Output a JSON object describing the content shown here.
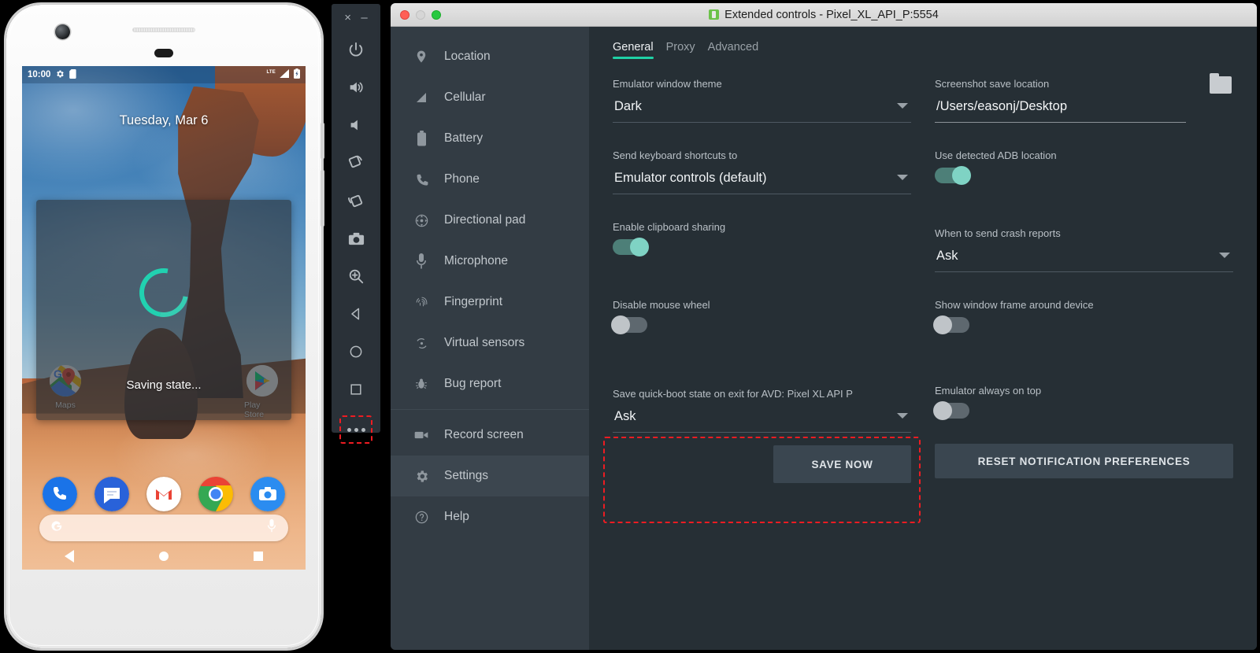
{
  "phone": {
    "status_bar": {
      "time": "10:00",
      "icons": [
        "gear-icon",
        "sdcard-icon",
        "lte-signal-icon",
        "battery-icon"
      ],
      "network_label": "LTE"
    },
    "date": "Tuesday, Mar 6",
    "dialog": {
      "message": "Saving state...",
      "spinner_color": "#21d1b0"
    },
    "home_apps": [
      {
        "label": "Maps",
        "icon": "maps-icon"
      },
      {
        "label": "Play Store",
        "icon": "play-store-icon"
      }
    ],
    "dock_apps": [
      {
        "label": "Phone",
        "icon": "phone-icon"
      },
      {
        "label": "Messages",
        "icon": "messages-icon"
      },
      {
        "label": "Gmail",
        "icon": "gmail-icon"
      },
      {
        "label": "Chrome",
        "icon": "chrome-icon"
      },
      {
        "label": "Camera",
        "icon": "camera-icon"
      }
    ],
    "search": {
      "left_icon": "google-g-icon",
      "right_icon": "microphone-icon",
      "placeholder": ""
    },
    "nav": [
      "back-button",
      "home-button",
      "overview-button"
    ]
  },
  "toolbar": {
    "close_label": "×",
    "minimize_label": "–",
    "buttons": [
      {
        "name": "power-button",
        "icon": "power-icon"
      },
      {
        "name": "volume-up-button",
        "icon": "volume-up-icon"
      },
      {
        "name": "volume-down-button",
        "icon": "volume-down-icon"
      },
      {
        "name": "rotate-left-button",
        "icon": "rotate-left-icon"
      },
      {
        "name": "rotate-right-button",
        "icon": "rotate-right-icon"
      },
      {
        "name": "screenshot-button",
        "icon": "camera-icon"
      },
      {
        "name": "zoom-button",
        "icon": "zoom-in-icon"
      },
      {
        "name": "back-button",
        "icon": "back-triangle-icon"
      },
      {
        "name": "home-button",
        "icon": "home-circle-icon"
      },
      {
        "name": "overview-button",
        "icon": "overview-square-icon"
      },
      {
        "name": "more-button",
        "icon": "more-dots-icon",
        "highlighted": true
      }
    ]
  },
  "window": {
    "title": "Extended controls - Pixel_XL_API_P:5554",
    "app_icon": "android-emulator-icon"
  },
  "sidebar": {
    "items": [
      {
        "label": "Location",
        "icon": "location-pin-icon",
        "selected": false
      },
      {
        "label": "Cellular",
        "icon": "cellular-signal-icon",
        "selected": false
      },
      {
        "label": "Battery",
        "icon": "battery-icon",
        "selected": false
      },
      {
        "label": "Phone",
        "icon": "phone-handset-icon",
        "selected": false
      },
      {
        "label": "Directional pad",
        "icon": "dpad-icon",
        "selected": false
      },
      {
        "label": "Microphone",
        "icon": "microphone-icon",
        "selected": false
      },
      {
        "label": "Fingerprint",
        "icon": "fingerprint-icon",
        "selected": false
      },
      {
        "label": "Virtual sensors",
        "icon": "virtual-sensors-icon",
        "selected": false
      },
      {
        "label": "Bug report",
        "icon": "bug-icon",
        "selected": false
      },
      {
        "label": "Record screen",
        "icon": "video-camera-icon",
        "selected": false
      },
      {
        "label": "Settings",
        "icon": "gear-icon",
        "selected": true
      },
      {
        "label": "Help",
        "icon": "question-circle-icon",
        "selected": false
      }
    ]
  },
  "tabs": [
    {
      "label": "General",
      "active": true
    },
    {
      "label": "Proxy",
      "active": false
    },
    {
      "label": "Advanced",
      "active": false
    }
  ],
  "settings": {
    "theme": {
      "label": "Emulator window theme",
      "value": "Dark"
    },
    "keyboard_shortcuts": {
      "label": "Send keyboard shortcuts to",
      "value": "Emulator controls (default)"
    },
    "clipboard": {
      "label": "Enable clipboard sharing",
      "state": "on"
    },
    "mouse_wheel": {
      "label": "Disable mouse wheel",
      "state": "off"
    },
    "quickboot": {
      "label": "Save quick-boot state on exit for AVD: Pixel XL API P",
      "value": "Ask",
      "save_button": "SAVE NOW",
      "highlighted": true
    },
    "screenshot_location": {
      "label": "Screenshot save location",
      "value": "/Users/easonj/Desktop",
      "browse_icon": "folder-icon"
    },
    "adb_location": {
      "label": "Use detected ADB location",
      "state": "on"
    },
    "crash_reports": {
      "label": "When to send crash reports",
      "value": "Ask"
    },
    "window_frame": {
      "label": "Show window frame around device",
      "state": "off"
    },
    "always_on_top": {
      "label": "Emulator always on top",
      "state": "off"
    },
    "reset_button": "RESET NOTIFICATION PREFERENCES"
  },
  "colors": {
    "accent_teal": "#1fd1a5",
    "highlight_red": "#ee1c22",
    "panel_bg": "#262f35",
    "sidebar_bg": "#333c44",
    "toggle_on": "#7fd3c4"
  }
}
